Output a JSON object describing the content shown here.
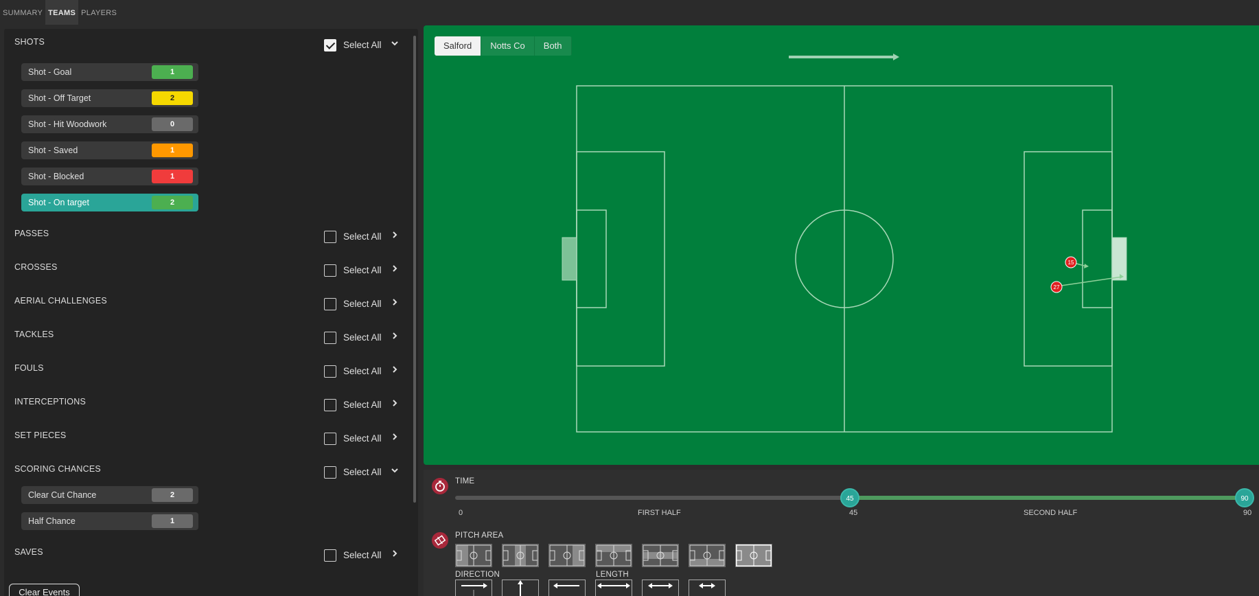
{
  "top_tabs": [
    {
      "label": "SUMMARY",
      "active": false
    },
    {
      "label": "TEAMS",
      "active": true
    },
    {
      "label": "PLAYERS",
      "active": false
    }
  ],
  "categories": {
    "shots": {
      "title": "SHOTS",
      "select_all": "Select All",
      "checked": true,
      "expanded": true
    },
    "passes": {
      "title": "PASSES",
      "select_all": "Select All"
    },
    "crosses": {
      "title": "CROSSES",
      "select_all": "Select All"
    },
    "aerial": {
      "title": "AERIAL CHALLENGES",
      "select_all": "Select All"
    },
    "tackles": {
      "title": "TACKLES",
      "select_all": "Select All"
    },
    "fouls": {
      "title": "FOULS",
      "select_all": "Select All"
    },
    "interceptions": {
      "title": "INTERCEPTIONS",
      "select_all": "Select All"
    },
    "set_pieces": {
      "title": "SET PIECES",
      "select_all": "Select All"
    },
    "scoring": {
      "title": "SCORING CHANCES",
      "select_all": "Select All",
      "expanded": true
    },
    "saves": {
      "title": "SAVES",
      "select_all": "Select All"
    }
  },
  "shot_events": [
    {
      "label": "Shot - Goal",
      "count": "1",
      "color": "#4caf50"
    },
    {
      "label": "Shot - Off Target",
      "count": "2",
      "color": "#f5d800"
    },
    {
      "label": "Shot - Hit Woodwork",
      "count": "0",
      "color": "#6a6a6a"
    },
    {
      "label": "Shot - Saved",
      "count": "1",
      "color": "#ff9800"
    },
    {
      "label": "Shot - Blocked",
      "count": "1",
      "color": "#f03c3c"
    },
    {
      "label": "Shot - On target",
      "count": "2",
      "color": "#4caf50",
      "active": true
    }
  ],
  "scoring_events": [
    {
      "label": "Clear Cut Chance",
      "count": "2",
      "color": "#6a6a6a"
    },
    {
      "label": "Half Chance",
      "count": "1",
      "color": "#6a6a6a"
    }
  ],
  "clear_events_label": "Clear Events",
  "team_tabs": [
    {
      "label": "Salford",
      "active": true
    },
    {
      "label": "Notts Co",
      "active": false
    },
    {
      "label": "Both",
      "active": false
    }
  ],
  "pitch_markers": [
    {
      "number": "15"
    },
    {
      "number": "27"
    }
  ],
  "controls": {
    "time_label": "TIME",
    "time_range": [
      45,
      90
    ],
    "handle_start": "45",
    "handle_end": "90",
    "ticks": [
      "0",
      "FIRST HALF",
      "45",
      "SECOND HALF",
      "90"
    ],
    "pitch_area_label": "PITCH AREA",
    "direction_label": "DIRECTION",
    "length_label": "LENGTH"
  },
  "colors": {
    "pitch": "#017f3c",
    "accent": "#2aa598",
    "marker": "#e02020",
    "icon_bg": "#a8283b"
  }
}
